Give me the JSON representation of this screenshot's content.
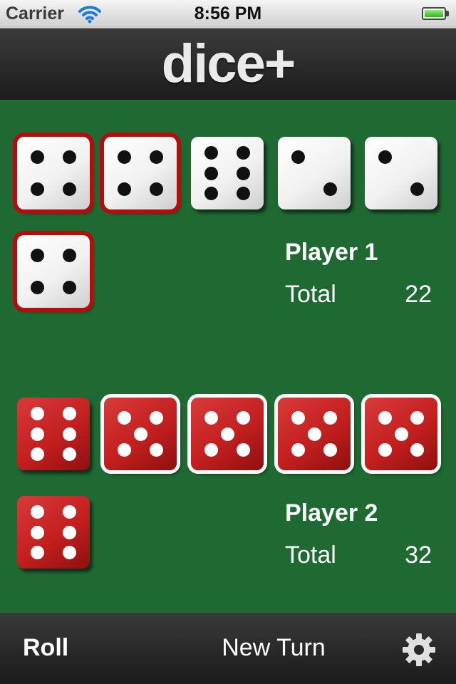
{
  "status_bar": {
    "carrier": "Carrier",
    "time": "8:56 PM"
  },
  "header": {
    "title": "dice+"
  },
  "player1": {
    "name": "Player 1",
    "total_label": "Total",
    "total_value": "22",
    "dice": [
      {
        "value": 4,
        "held": true
      },
      {
        "value": 4,
        "held": true
      },
      {
        "value": 6,
        "held": false
      },
      {
        "value": 2,
        "held": false
      },
      {
        "value": 2,
        "held": false
      },
      {
        "value": 4,
        "held": true
      }
    ]
  },
  "player2": {
    "name": "Player 2",
    "total_label": "Total",
    "total_value": "32",
    "dice": [
      {
        "value": 6,
        "held": false
      },
      {
        "value": 5,
        "held": true
      },
      {
        "value": 5,
        "held": true
      },
      {
        "value": 5,
        "held": true
      },
      {
        "value": 5,
        "held": true
      },
      {
        "value": 6,
        "held": false
      }
    ]
  },
  "toolbar": {
    "roll_label": "Roll",
    "new_turn_label": "New Turn",
    "settings_icon": "gear-icon"
  },
  "colors": {
    "table_green": "#1f6a33",
    "die_red": "#c31f1f",
    "die_white": "#f1f1f1"
  }
}
